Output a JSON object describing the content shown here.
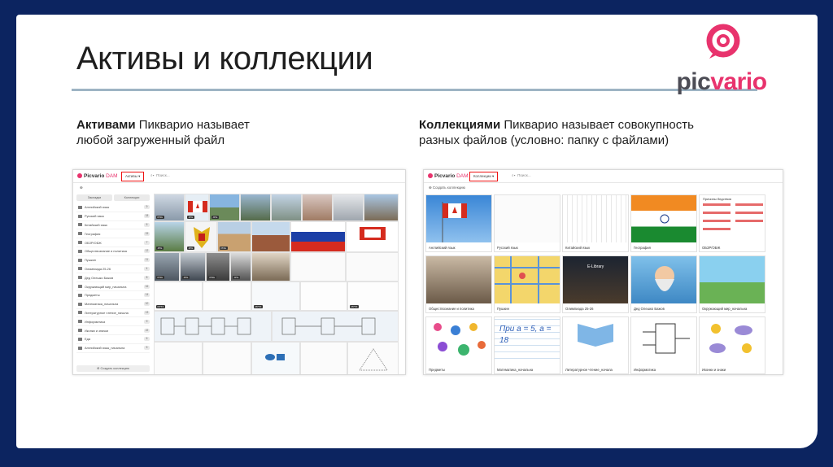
{
  "slide": {
    "title": "Активы и коллекции",
    "logo": {
      "text_a": "pic",
      "text_b": "vario",
      "brand_color": "#e8336d",
      "text_color": "#4c4c55"
    },
    "left_desc": {
      "bold": "Активами",
      "rest_line1": " Пикварио называет",
      "line2": "любой загруженный файл"
    },
    "right_desc": {
      "bold": "Коллекциями",
      "rest_line1": " Пикварио называет совокупность",
      "line2": "разных файлов (условно: папку с файлами)"
    },
    "colors": {
      "background": "#0c2460",
      "rule": "#9eb4c4",
      "highlight": "#ee1111"
    }
  },
  "assets_screen": {
    "logo_text": "Picvario",
    "logo_suffix": "DAM",
    "section_dropdown": "Активы",
    "search_placeholder": "Поиск...",
    "tabs": [
      "Закладки",
      "Коллекции"
    ],
    "sidebar": [
      {
        "label": "Английский язык",
        "count": "9"
      },
      {
        "label": "Русский язык",
        "count": "18"
      },
      {
        "label": "Китайский язык",
        "count": "6"
      },
      {
        "label": "География",
        "count": "15"
      },
      {
        "label": "ОБЗР/ОБЖ",
        "count": "7"
      },
      {
        "label": "Обществознание и политика",
        "count": "12"
      },
      {
        "label": "Пушкин",
        "count": "11"
      },
      {
        "label": "Олимпиада 25-26",
        "count": "4"
      },
      {
        "label": "Дед Олешко Бажов",
        "count": "8"
      },
      {
        "label": "Окружающий мир_начальна",
        "count": "16"
      },
      {
        "label": "Предметы",
        "count": "14"
      },
      {
        "label": "Математика_начальна",
        "count": "10"
      },
      {
        "label": "Литературное чтение_начала",
        "count": "13"
      },
      {
        "label": "Информатика",
        "count": "9"
      },
      {
        "label": "Иконки и значки",
        "count": "22"
      },
      {
        "label": "Еда",
        "count": "6"
      },
      {
        "label": "Английский язык_начальна",
        "count": "5"
      }
    ],
    "create_button": "Создать коллекцию",
    "file_tags": [
      "PNG",
      "JPG",
      "JPG",
      "JPG",
      "JPG",
      "PNG",
      "PNG",
      "JPG",
      "PNG",
      "JPG",
      "PPTX",
      "PPTX",
      "PPTX"
    ]
  },
  "collections_screen": {
    "logo_text": "Picvario",
    "logo_suffix": "DAM",
    "section_dropdown": "Коллекции",
    "search_placeholder": "Поиск...",
    "create_link": "Создать коллекцию",
    "cards": [
      {
        "label": "Английский язык"
      },
      {
        "label": "Русский язык"
      },
      {
        "label": "Китайский язык"
      },
      {
        "label": "География"
      },
      {
        "label": "ОБЗР/ОБЖ",
        "overlay": "Причины бедствия"
      },
      {
        "label": "Обществознание и политика"
      },
      {
        "label": "Пушкин"
      },
      {
        "label": "Олимпиада 25-26",
        "overlay": "E-Library"
      },
      {
        "label": "Дед Олешко Бажов"
      },
      {
        "label": "Окружающий мир_начальна"
      },
      {
        "label": "Предметы"
      },
      {
        "label": "Математика_начальна",
        "overlay": "При a = 5, a = 18"
      },
      {
        "label": "Литературное чтение_начала"
      },
      {
        "label": "Информатика"
      },
      {
        "label": "Иконки и знаки"
      }
    ]
  }
}
